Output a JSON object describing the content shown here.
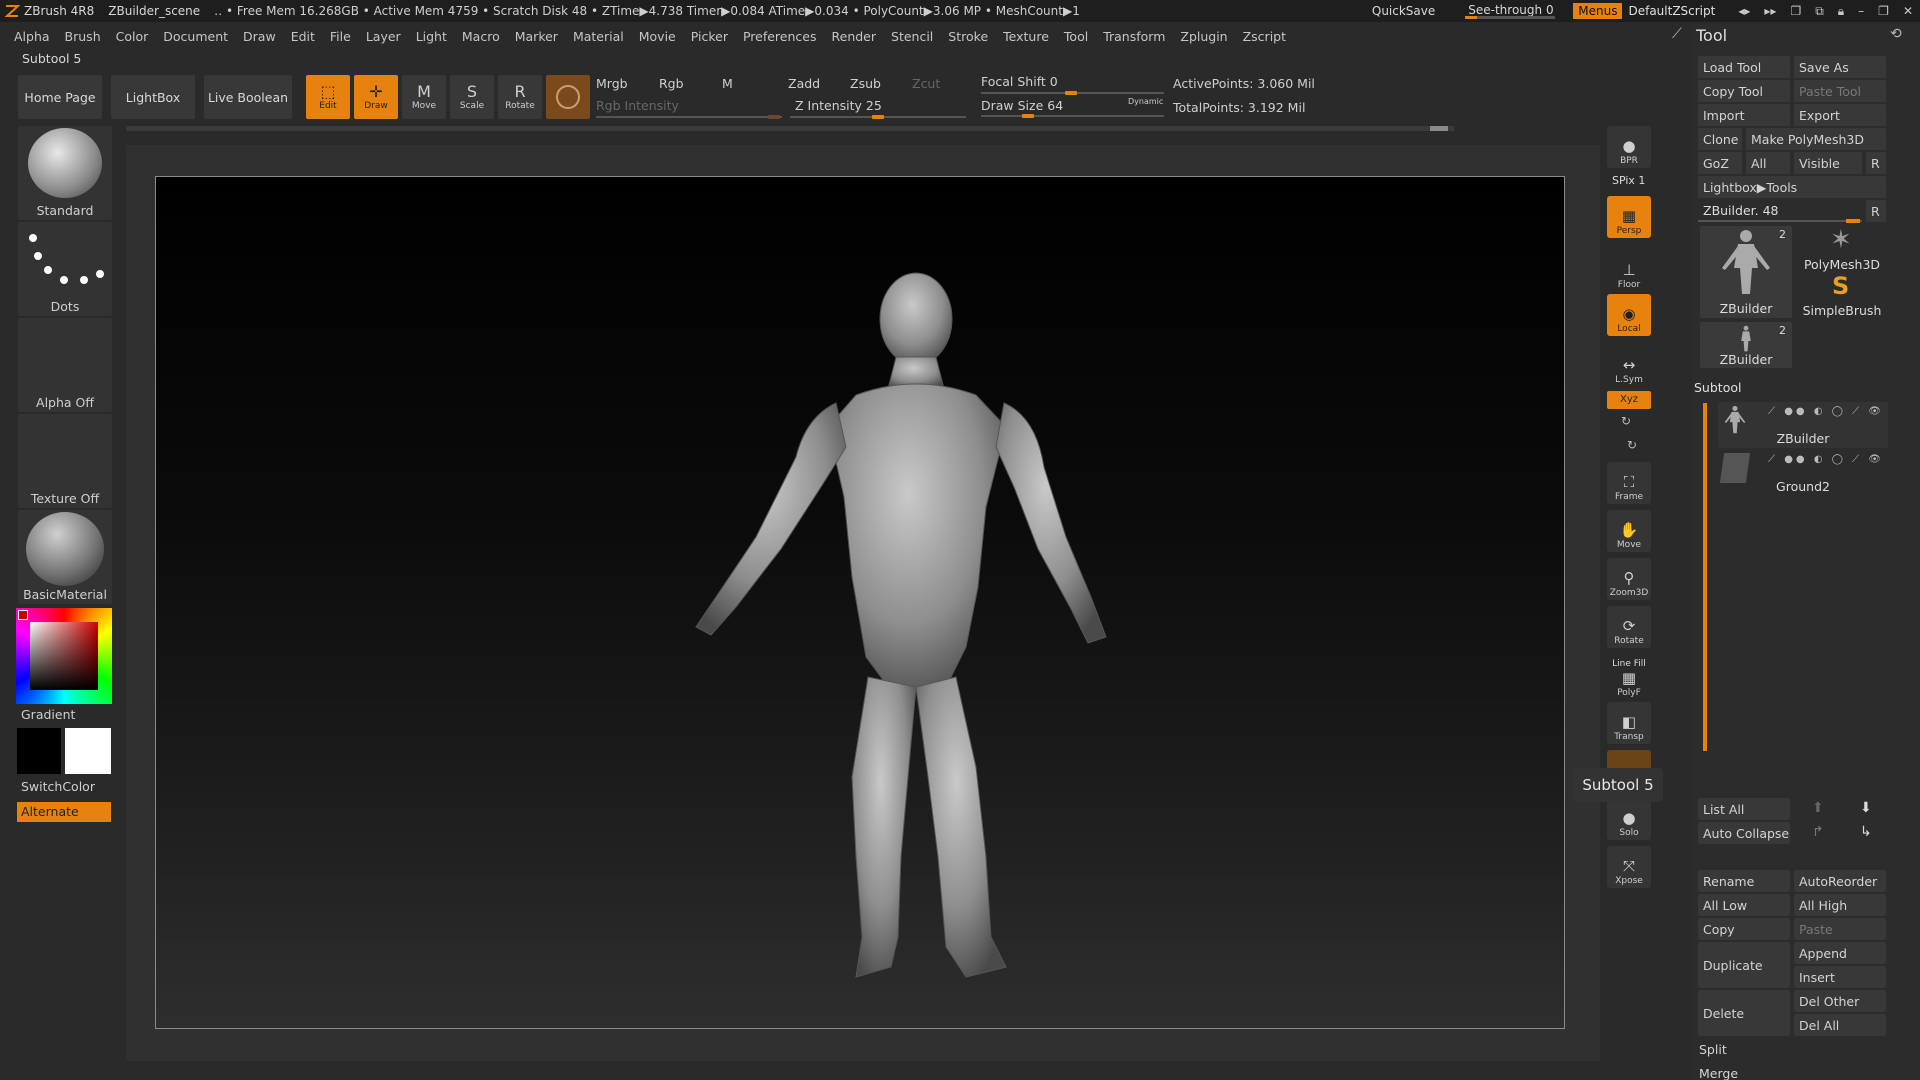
{
  "titlebar": {
    "app": "ZBrush 4R8",
    "scene": "ZBuilder_scene",
    "stats": "‥ • Free Mem 16.268GB • Active Mem 4759 • Scratch Disk 48 • ZTime▶4.738 Timer▶0.084 ATime▶0.034 • PolyCount▶3.06 MP • MeshCount▶1",
    "quicksave": "QuickSave",
    "seethrough": "See-through   0",
    "seethrough_value": 0,
    "menus": "Menus",
    "script": "DefaultZScript"
  },
  "menubar": [
    "Alpha",
    "Brush",
    "Color",
    "Document",
    "Draw",
    "Edit",
    "File",
    "Layer",
    "Light",
    "Macro",
    "Marker",
    "Material",
    "Movie",
    "Picker",
    "Preferences",
    "Render",
    "Stencil",
    "Stroke",
    "Texture",
    "Tool",
    "Transform",
    "Zplugin",
    "Zscript"
  ],
  "subtool_label": "Subtool 5",
  "shelf": {
    "home": "Home Page",
    "lightbox": "LightBox",
    "boolean": "Live Boolean",
    "edit": "Edit",
    "draw": "Draw",
    "move": "Move",
    "scale": "Scale",
    "rotate": "Rotate",
    "mrgb": "Mrgb",
    "rgb": "Rgb",
    "m": "M",
    "rgb_intensity": "Rgb Intensity",
    "zadd": "Zadd",
    "zsub": "Zsub",
    "zcut": "Zcut",
    "z_intensity": "Z Intensity 25",
    "focal_shift": "Focal Shift 0",
    "draw_size": "Draw Size 64",
    "dynamic": "Dynamic",
    "active_points": "ActivePoints: 3.060 Mil",
    "total_points": "TotalPoints: 3.192 Mil"
  },
  "left": {
    "brush": "Standard",
    "stroke": "Dots",
    "alpha": "Alpha Off",
    "texture": "Texture Off",
    "material": "BasicMaterial",
    "gradient": "Gradient",
    "switchcolor": "SwitchColor",
    "alternate": "Alternate"
  },
  "righttoolbar": {
    "bpr": "BPR",
    "spix": "SPix 1",
    "persp": "Persp",
    "floor": "Floor",
    "local": "Local",
    "lsym": "L.Sym",
    "xyz": "Xyz",
    "frame": "Frame",
    "move": "Move",
    "zoom3d": "Zoom3D",
    "rotate": "Rotate",
    "linefill": "Line Fill",
    "polyf": "PolyF",
    "transp": "Transp",
    "solo": "Solo",
    "xpose": "Xpose"
  },
  "tooltip": "Subtool 5",
  "tool": {
    "title": "Tool",
    "load": "Load Tool",
    "saveas": "Save As",
    "copy": "Copy Tool",
    "paste": "Paste Tool",
    "import": "Import",
    "export": "Export",
    "clone": "Clone",
    "make": "Make PolyMesh3D",
    "goz": "GoZ",
    "all": "All",
    "visible": "Visible",
    "r": "R",
    "lightbox_tools": "Lightbox▶Tools",
    "zbuilder_slider": "ZBuilder. 48",
    "thumbs": [
      {
        "name": "ZBuilder",
        "count": "2"
      },
      {
        "name": "PolyMesh3D",
        "count": ""
      },
      {
        "name": "SimpleBrush",
        "count": ""
      },
      {
        "name": "ZBuilder",
        "count": "2"
      }
    ],
    "subtool_header": "Subtool",
    "subtools": [
      "ZBuilder",
      "Ground2"
    ],
    "listall": "List All",
    "autocollapse": "Auto Collapse",
    "rename": "Rename",
    "autoreorder": "AutoReorder",
    "alllow": "All Low",
    "allhigh": "All High",
    "copy_btn": "Copy",
    "paste_btn": "Paste",
    "duplicate": "Duplicate",
    "append": "Append",
    "insert": "Insert",
    "delete": "Delete",
    "delother": "Del Other",
    "delall": "Del All",
    "split": "Split",
    "merge": "Merge"
  },
  "colors": {
    "accent": "#e8820f",
    "bg": "#2a2a2a"
  }
}
